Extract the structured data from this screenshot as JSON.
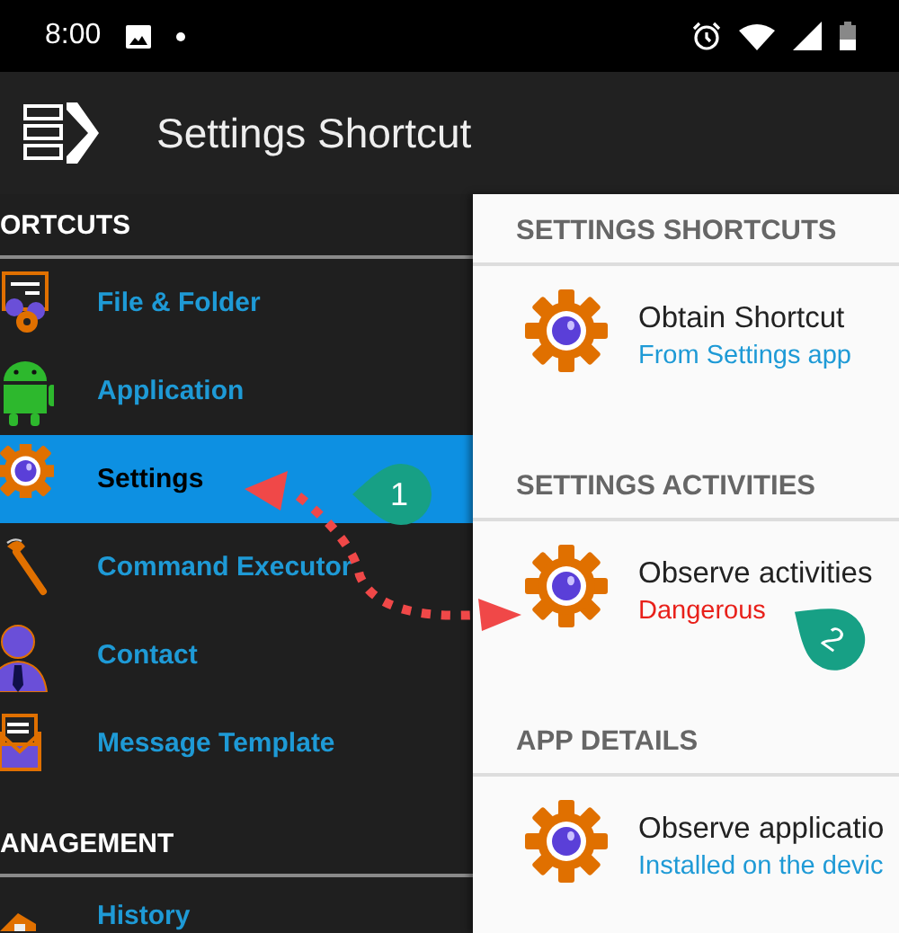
{
  "status_bar": {
    "time": "8:00"
  },
  "toolbar": {
    "title": "Settings Shortcut"
  },
  "drawer": {
    "sections": [
      {
        "header": "ORTCUTS",
        "items": [
          {
            "label": "File & Folder",
            "selected": false
          },
          {
            "label": "Application",
            "selected": false
          },
          {
            "label": "Settings",
            "selected": true
          },
          {
            "label": "Command Executor",
            "selected": false
          },
          {
            "label": "Contact",
            "selected": false
          },
          {
            "label": "Message Template",
            "selected": false
          }
        ]
      },
      {
        "header": "ANAGEMENT",
        "items": [
          {
            "label": "History",
            "selected": false
          }
        ]
      }
    ]
  },
  "panel": {
    "sections": [
      {
        "header": "SETTINGS SHORTCUTS",
        "items": [
          {
            "title": "Obtain Shortcut",
            "subtitle": "From Settings app",
            "kind": "info"
          }
        ]
      },
      {
        "header": "SETTINGS ACTIVITIES",
        "items": [
          {
            "title": "Observe activities",
            "subtitle": "Dangerous",
            "kind": "danger"
          }
        ]
      },
      {
        "header": "APP DETAILS",
        "items": [
          {
            "title": "Observe applicatio",
            "subtitle": "Installed on the devic",
            "kind": "info"
          }
        ]
      }
    ]
  },
  "annotations": [
    {
      "label": "1"
    },
    {
      "label": "2"
    }
  ]
}
